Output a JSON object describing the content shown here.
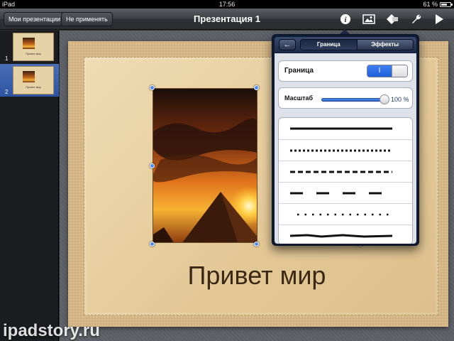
{
  "status_bar": {
    "device": "iPad",
    "time": "17:56",
    "battery": "61 %"
  },
  "toolbar": {
    "my_presentations_label": "Мои презентации",
    "dont_apply_label": "Не применять",
    "title": "Презентация 1",
    "icons": [
      "info-icon",
      "image-icon",
      "shapes-icon",
      "wrench-icon",
      "play-icon"
    ]
  },
  "sidebar": {
    "slides": [
      {
        "number": "1",
        "thumb_text": "Привет мир",
        "selected": false
      },
      {
        "number": "2",
        "thumb_text": "Привет мир",
        "selected": true
      }
    ]
  },
  "slide": {
    "title": "Привет мир"
  },
  "popover": {
    "tabs": [
      {
        "label": "Граница",
        "active": true
      },
      {
        "label": "Эффекты",
        "active": false
      }
    ],
    "border_label": "Граница",
    "border_toggle_text": "I",
    "border_enabled": true,
    "scale_label": "Масштаб",
    "scale_value": "100 %",
    "scale_fraction": 1.0,
    "line_styles": [
      "solid",
      "dotted",
      "dashed",
      "long-dash",
      "sparse-dotted",
      "rough"
    ]
  },
  "colors": {
    "accent": "#2f6be0",
    "selection": "#3b63b0",
    "popover_frame": "#0f1b33"
  },
  "watermark": "ipadstory.ru"
}
